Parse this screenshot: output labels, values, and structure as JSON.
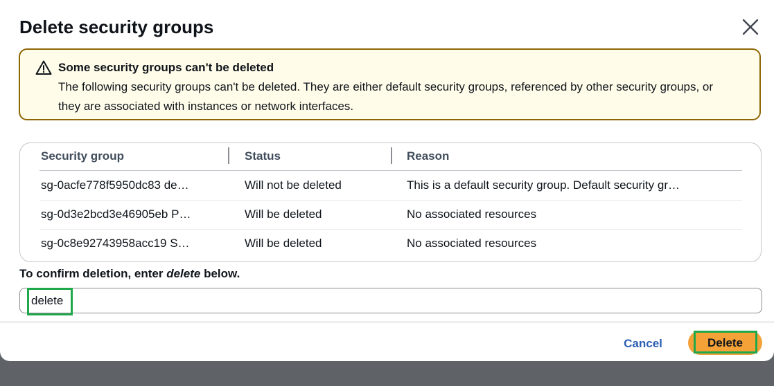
{
  "modal": {
    "title": "Delete security groups",
    "close_icon": "close-icon"
  },
  "alert": {
    "icon": "warning-icon",
    "heading": "Some security groups can't be deleted",
    "body": "The following security groups can't be deleted. They are either default security groups, referenced by other security groups, or they are associated with instances or network interfaces.",
    "border_color": "#8d6605",
    "background_color": "#fffce9"
  },
  "table": {
    "columns": [
      "Security group",
      "Status",
      "Reason"
    ],
    "rows": [
      {
        "security_group": "sg-0acfe778f5950dc83 de…",
        "status": "Will not be deleted",
        "reason": "This is a default security group. Default security gr…"
      },
      {
        "security_group": "sg-0d3e2bcd3e46905eb P…",
        "status": "Will be deleted",
        "reason": "No associated resources"
      },
      {
        "security_group": "sg-0c8e92743958acc19 S…",
        "status": "Will be deleted",
        "reason": "No associated resources"
      }
    ]
  },
  "confirm": {
    "label_prefix": "To confirm deletion, enter ",
    "label_keyword": "delete",
    "label_suffix": " below.",
    "input_value": "delete"
  },
  "footer": {
    "cancel_label": "Cancel",
    "delete_label": "Delete",
    "cancel_color": "#295eb3",
    "delete_color": "#f4a238",
    "highlight_color": "#1fa84a"
  }
}
